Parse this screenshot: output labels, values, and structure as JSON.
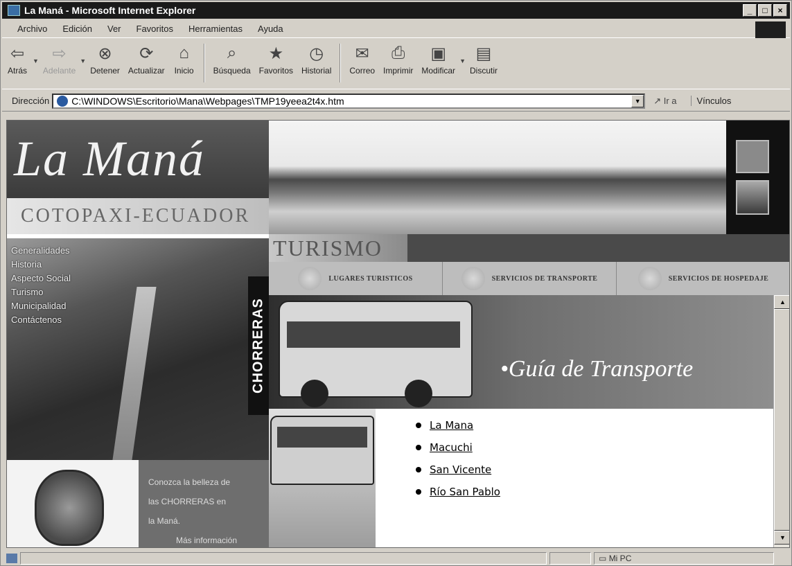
{
  "window": {
    "title": "La Maná - Microsoft Internet Explorer",
    "controls": [
      "_",
      "□",
      "×"
    ]
  },
  "menu": [
    "Archivo",
    "Edición",
    "Ver",
    "Favoritos",
    "Herramientas",
    "Ayuda"
  ],
  "toolbar": {
    "buttons": [
      {
        "label": "Atrás",
        "icon": "back-arrow-icon"
      },
      {
        "label": "Adelante",
        "icon": "forward-arrow-icon"
      },
      {
        "label": "Detener",
        "icon": "stop-icon"
      },
      {
        "label": "Actualizar",
        "icon": "refresh-icon"
      },
      {
        "label": "Inicio",
        "icon": "home-icon"
      },
      {
        "label": "Búsqueda",
        "icon": "search-icon"
      },
      {
        "label": "Favoritos",
        "icon": "favorites-icon"
      },
      {
        "label": "Historial",
        "icon": "history-icon"
      },
      {
        "label": "Correo",
        "icon": "mail-icon"
      },
      {
        "label": "Imprimir",
        "icon": "print-icon"
      },
      {
        "label": "Modificar",
        "icon": "edit-icon"
      },
      {
        "label": "Discutir",
        "icon": "discuss-icon"
      }
    ]
  },
  "address": {
    "label": "Dirección",
    "url": "C:\\WINDOWS\\Escritorio\\Mana\\Webpages\\TMP19yeea2t4x.htm",
    "go_label": "Ir a",
    "links_label": "Vínculos"
  },
  "site": {
    "logo": "La Maná",
    "subtitle": "COTOPAXI-ECUADOR",
    "nav": [
      "Generalidades",
      "Historia",
      "Aspecto Social",
      "Turismo",
      "Municipalidad",
      "Contáctenos"
    ],
    "side_banner": "CHORRERAS",
    "section": "TURISMO",
    "tabs": [
      "LUGARES TURISTICOS",
      "SERVICIOS DE TRANSPORTE",
      "SERVICIOS DE HOSPEDAJE"
    ],
    "guide_title": "•Guía de Transporte",
    "promo": [
      "Conozca la belleza de",
      "las CHORRERAS en",
      "la Maná.",
      "Más información"
    ],
    "routes": [
      "La Mana",
      "Macuchi",
      "San Vicente",
      "Río San Pablo"
    ]
  },
  "status": {
    "zone": "Mi PC"
  }
}
